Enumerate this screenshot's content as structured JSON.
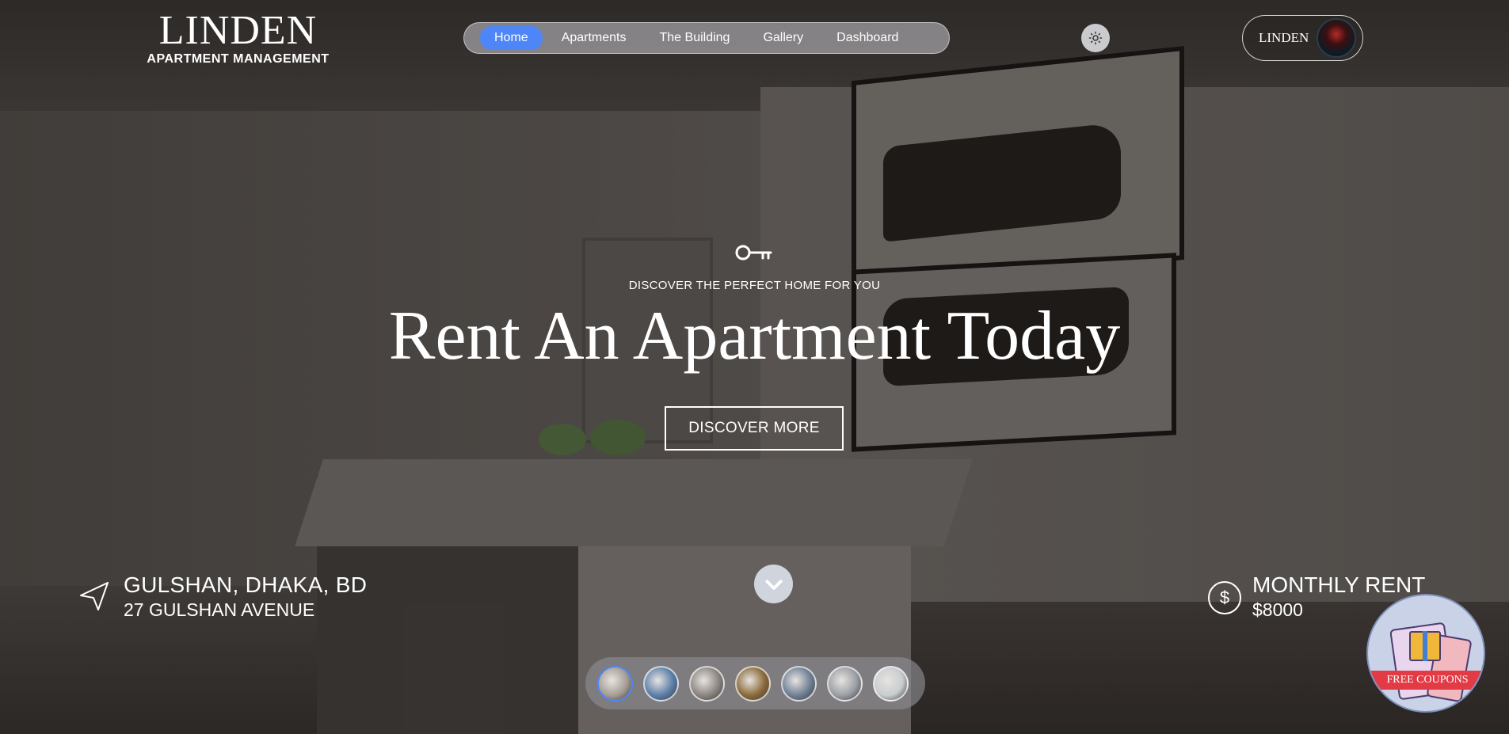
{
  "brand": {
    "title": "LINDEN",
    "subtitle": "APARTMENT MANAGEMENT"
  },
  "nav": {
    "items": [
      {
        "label": "Home",
        "active": true
      },
      {
        "label": "Apartments",
        "active": false
      },
      {
        "label": "The Building",
        "active": false
      },
      {
        "label": "Gallery",
        "active": false
      },
      {
        "label": "Dashboard",
        "active": false
      }
    ]
  },
  "header": {
    "theme_toggle_icon": "sun-icon",
    "user_name": "LINDEN",
    "avatar_icon": "avatar"
  },
  "hero": {
    "icon": "key-icon",
    "tagline": "DISCOVER THE PERFECT HOME FOR YOU",
    "headline": "Rent An Apartment Today",
    "cta_label": "DISCOVER MORE",
    "scroll_icon": "chevron-down-icon"
  },
  "location": {
    "icon": "navigation-arrow-icon",
    "title": "GULSHAN, DHAKA, BD",
    "address": "27 GULSHAN AVENUE"
  },
  "rent": {
    "icon": "dollar-icon",
    "symbol": "$",
    "title": "MONTHLY RENT",
    "amount": "$8000"
  },
  "thumbnails": {
    "count": 7,
    "active_index": 0,
    "colors": [
      "#a59d94",
      "#5b7fa8",
      "#8a8580",
      "#8a6a3a",
      "#6f7f95",
      "#9a9ea4",
      "#c8ccd0"
    ]
  },
  "coupon": {
    "label": "FREE COUPONS",
    "colors": {
      "banner": "#e23b45",
      "gift": "#f0b73a"
    }
  },
  "colors": {
    "accent": "#4f86f7"
  }
}
